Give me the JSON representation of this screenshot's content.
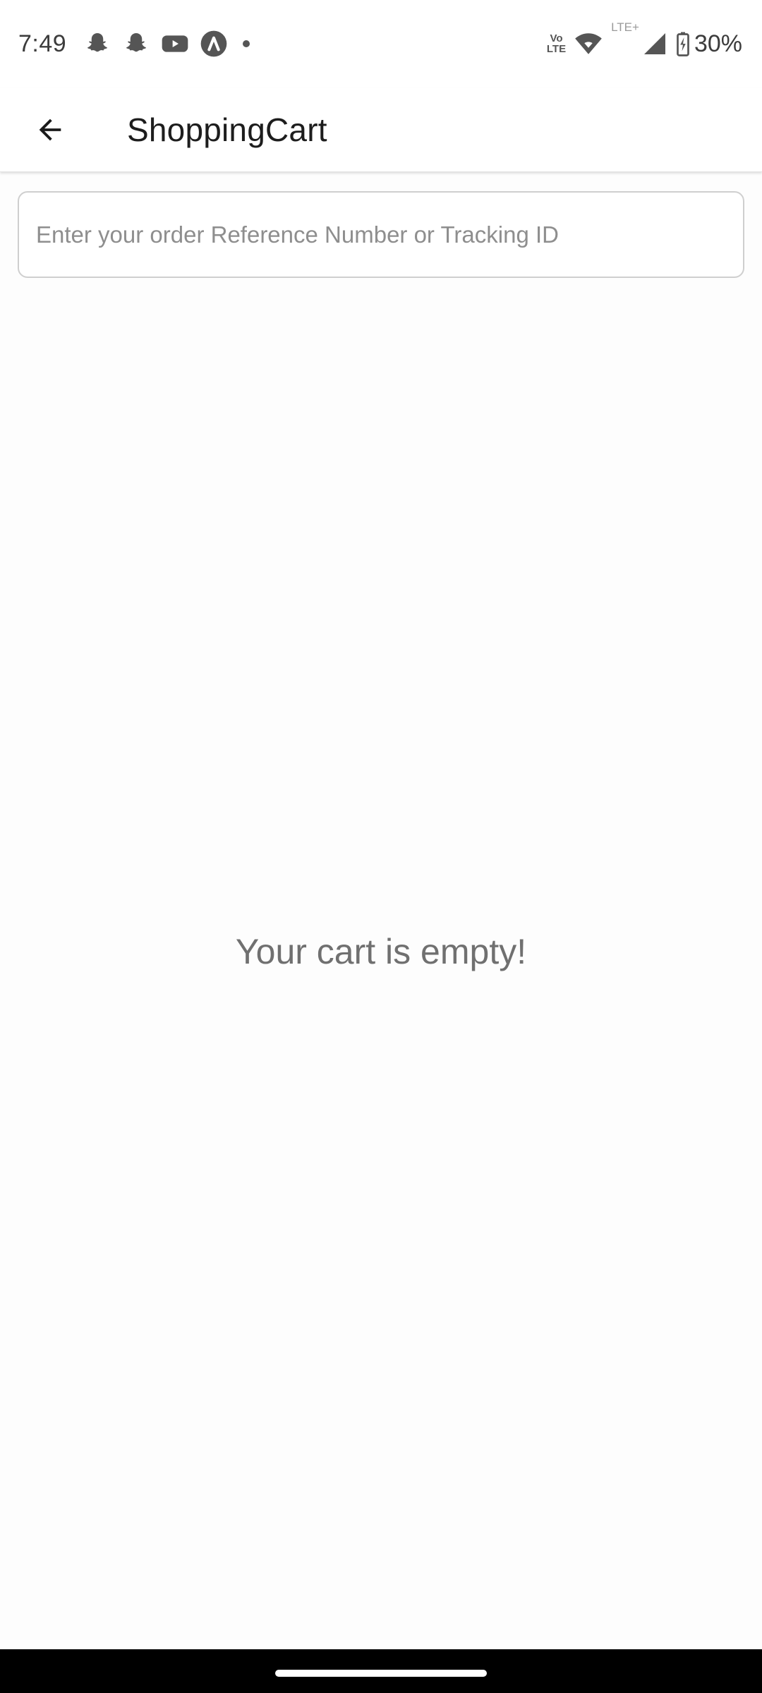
{
  "status_bar": {
    "time": "7:49",
    "notification_icons": [
      "snapchat-icon",
      "snapchat-icon",
      "youtube-icon",
      "app-a-icon",
      "more-dot-icon"
    ],
    "network_label": "LTE+",
    "volte_label_top": "Vo",
    "volte_label_bottom": "LTE",
    "battery_percent": "30%"
  },
  "app_bar": {
    "title": "ShoppingCart",
    "back_icon": "arrow-back-icon"
  },
  "search": {
    "placeholder": "Enter your order Reference Number or Tracking ID",
    "value": ""
  },
  "cart": {
    "empty_message": "Your cart is empty!"
  },
  "colors": {
    "background": "#ffffff",
    "text_primary": "#1d1d1d",
    "text_secondary": "#707070",
    "border": "#cfcfcf"
  }
}
